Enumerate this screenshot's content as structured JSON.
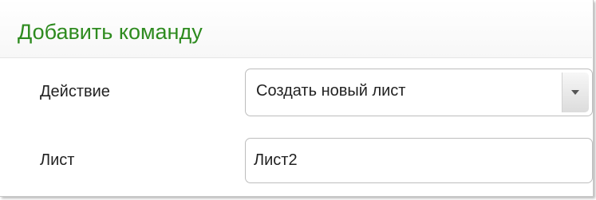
{
  "dialog": {
    "title": "Добавить команду"
  },
  "form": {
    "action": {
      "label": "Действие",
      "selected_value": "Создать новый лист"
    },
    "sheet": {
      "label": "Лист",
      "value": "Лист2"
    }
  },
  "icons": {
    "dropdown": "chevron-down-icon"
  },
  "colors": {
    "title": "#2e8b1f",
    "border": "#bdbdbd",
    "text": "#222222"
  }
}
